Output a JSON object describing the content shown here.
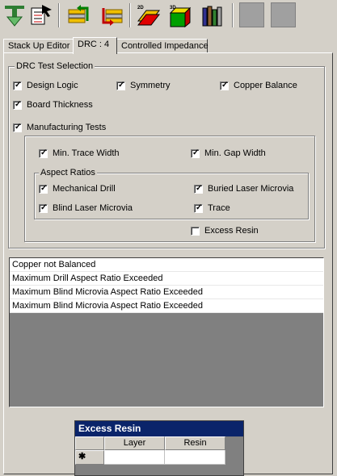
{
  "toolbar": {
    "buttons": [
      {
        "icon": "insert-layer-icon"
      },
      {
        "icon": "checklist-pointer-icon"
      },
      {
        "icon": "stack-move-up-icon"
      },
      {
        "icon": "stack-move-down-icon"
      },
      {
        "icon": "2d-view-icon",
        "label": "2D"
      },
      {
        "icon": "3d-view-icon",
        "label": "3D"
      },
      {
        "icon": "library-books-icon"
      }
    ]
  },
  "tabs": [
    {
      "label": "Stack Up Editor"
    },
    {
      "label": "DRC : 4",
      "active": true
    },
    {
      "label": "Controlled Impedance"
    }
  ],
  "drc": {
    "group_title": "DRC Test Selection",
    "design_logic": {
      "label": "Design Logic",
      "checked": true
    },
    "symmetry": {
      "label": "Symmetry",
      "checked": true
    },
    "copper_balance": {
      "label": "Copper Balance",
      "checked": true
    },
    "board_thickness": {
      "label": "Board Thickness",
      "checked": true
    },
    "manufacturing_tests": {
      "label": "Manufacturing Tests",
      "checked": true
    },
    "min_trace_width": {
      "label": "Min. Trace Width",
      "checked": true
    },
    "min_gap_width": {
      "label": "Min. Gap Width",
      "checked": true
    },
    "aspect_title": "Aspect Ratios",
    "mechanical_drill": {
      "label": "Mechanical Drill",
      "checked": true
    },
    "buried_laser_microvia": {
      "label": "Buried Laser Microvia",
      "checked": true
    },
    "blind_laser_microvia": {
      "label": "Blind Laser Microvia",
      "checked": true
    },
    "trace": {
      "label": "Trace",
      "checked": true
    },
    "excess_resin": {
      "label": "Excess Resin",
      "checked": false
    }
  },
  "errors": [
    "Copper not Balanced",
    "Maximum Drill Aspect Ratio Exceeded",
    "Maximum Blind Microvia Aspect Ratio Exceeded",
    "Maximum Blind Microvia Aspect Ratio Exceeded"
  ],
  "excess_resin_grid": {
    "title": "Excess Resin",
    "columns": [
      "Layer",
      "Resin"
    ],
    "new_row_marker": "✱"
  }
}
